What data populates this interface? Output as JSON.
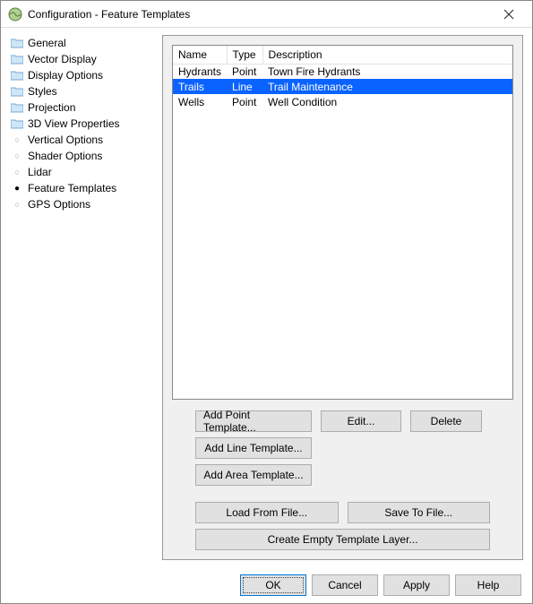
{
  "window": {
    "title": "Configuration - Feature Templates",
    "close_label": "✕"
  },
  "sidebar": {
    "items": [
      {
        "label": "General",
        "kind": "folder",
        "selected": false
      },
      {
        "label": "Vector Display",
        "kind": "folder",
        "selected": false
      },
      {
        "label": "Display Options",
        "kind": "folder",
        "selected": false
      },
      {
        "label": "Styles",
        "kind": "folder",
        "selected": false
      },
      {
        "label": "Projection",
        "kind": "folder",
        "selected": false
      },
      {
        "label": "3D View Properties",
        "kind": "folder",
        "selected": false
      },
      {
        "label": "Vertical Options",
        "kind": "bullet",
        "selected": false
      },
      {
        "label": "Shader Options",
        "kind": "bullet",
        "selected": false
      },
      {
        "label": "Lidar",
        "kind": "bullet",
        "selected": false
      },
      {
        "label": "Feature Templates",
        "kind": "bullet",
        "selected": true
      },
      {
        "label": "GPS Options",
        "kind": "bullet",
        "selected": false
      }
    ]
  },
  "table": {
    "headers": {
      "name": "Name",
      "type": "Type",
      "description": "Description"
    },
    "rows": [
      {
        "name": "Hydrants",
        "type": "Point",
        "description": "Town Fire Hydrants",
        "selected": false
      },
      {
        "name": "Trails",
        "type": "Line",
        "description": "Trail Maintenance",
        "selected": true
      },
      {
        "name": "Wells",
        "type": "Point",
        "description": "Well Condition",
        "selected": false
      }
    ]
  },
  "buttons": {
    "add_point": "Add Point Template...",
    "edit": "Edit...",
    "delete": "Delete",
    "add_line": "Add Line Template...",
    "add_area": "Add Area Template...",
    "load_file": "Load From File...",
    "save_file": "Save To File...",
    "create_empty": "Create Empty Template Layer..."
  },
  "footer": {
    "ok": "OK",
    "cancel": "Cancel",
    "apply": "Apply",
    "help": "Help"
  }
}
